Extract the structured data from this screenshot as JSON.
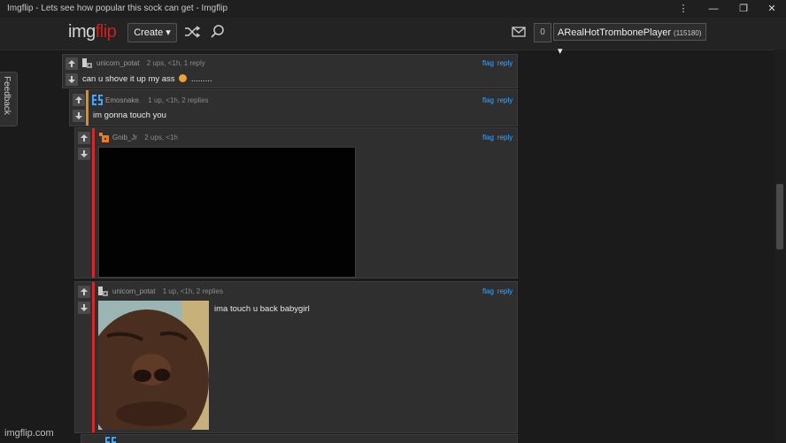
{
  "window": {
    "title": "Imgflip - Lets see how popular this sock can get - Imgflip",
    "controls": [
      "⋮",
      "—",
      "❐",
      "✕"
    ]
  },
  "header": {
    "logo_a": "img",
    "logo_b": "flip",
    "create_label": "Create ▾",
    "notif_count": "0",
    "username": "ARealHotTrombonePlayer",
    "user_points": "(115180)",
    "user_caret": "▾",
    "icons": [
      "shuffle-icon",
      "search-icon",
      "mail-icon"
    ]
  },
  "feedback": {
    "label": "Feedback"
  },
  "comments": [
    {
      "username": "unicorn_potat",
      "meta": "2 ups, <1h, 1 reply",
      "text_a": "can u shove it up my ass",
      "text_b": ".........",
      "flag": "flag",
      "reply": "reply",
      "bar_color": "",
      "avatar": "unicorn"
    },
    {
      "username": "Emosnake.",
      "meta": "1 up, <1h, 2 replies",
      "text": "im gonna touch you",
      "flag": "flag",
      "reply": "reply",
      "bar_color": "#e68a19",
      "avatar": "emo"
    },
    {
      "username": "Gnib_Jr",
      "meta": "2 ups, <1h",
      "flag": "flag",
      "reply": "reply",
      "bar_color": "#d02a2a",
      "avatar": "gnib",
      "image": "black-image"
    },
    {
      "username": "unicorn_potat",
      "meta": "1 up, <1h, 2 replies",
      "text": "ima touch u back babygirl",
      "flag": "flag",
      "reply": "reply",
      "bar_color": "#d02a2a",
      "avatar": "unicorn",
      "image": "face-photo"
    }
  ],
  "footer": {
    "brand": "imgflip.com"
  },
  "colors": {
    "accent_red": "#d01f1f",
    "link_blue": "#3ea6ff",
    "orange_bar": "#e68a19",
    "red_bar": "#d02a2a"
  }
}
